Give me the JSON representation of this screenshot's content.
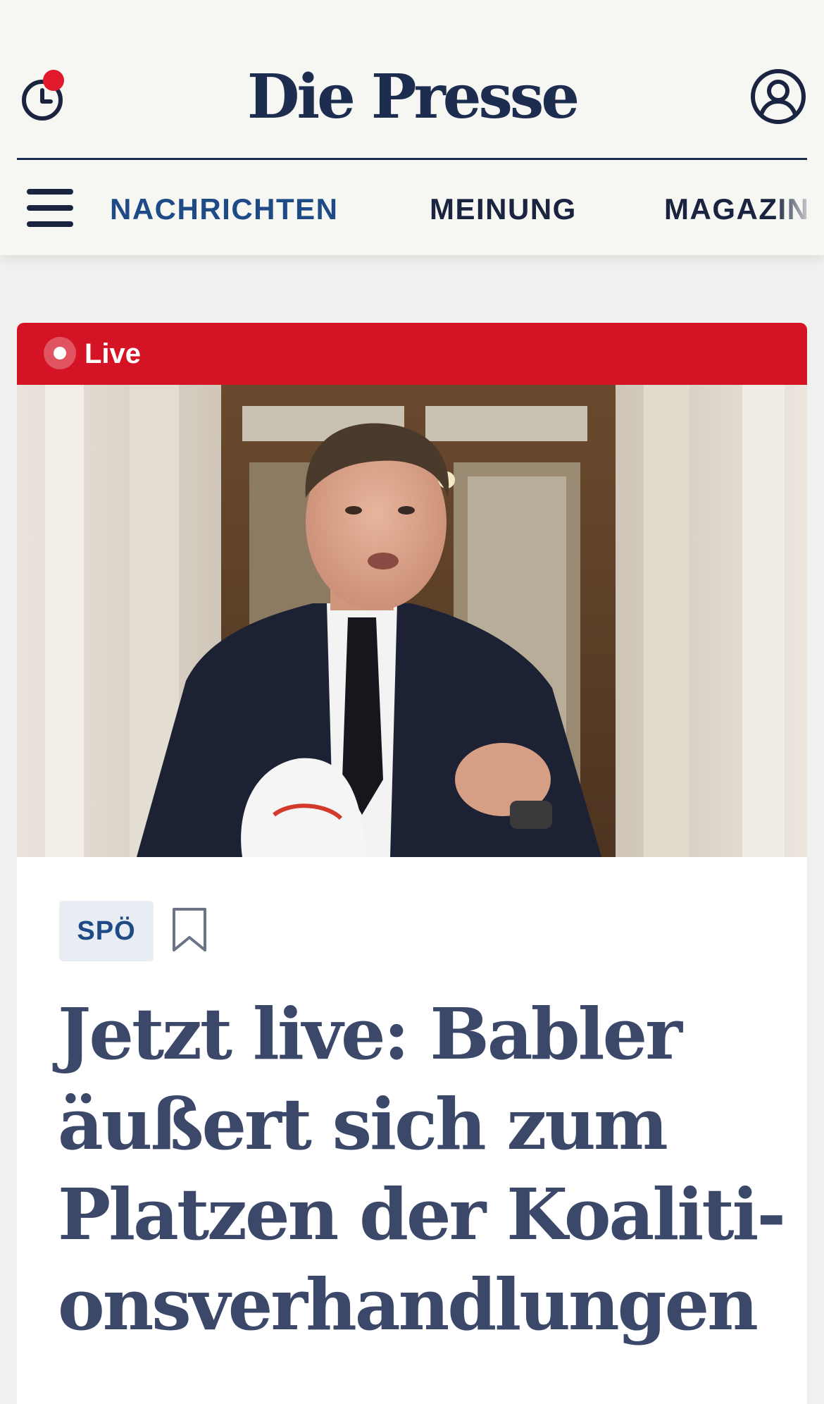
{
  "header": {
    "logo": "Die Presse",
    "notification_dot_color": "#e2182d",
    "icons": [
      "history-icon",
      "account-icon",
      "menu-icon"
    ]
  },
  "nav": {
    "items": [
      {
        "label": "NACHRICHTEN",
        "active": true
      },
      {
        "label": "MEINUNG",
        "active": false
      },
      {
        "label": "MAGAZIN",
        "active": false
      }
    ]
  },
  "article": {
    "live_label": "Live",
    "live_color": "#d41325",
    "tag": "SPÖ",
    "headline_lines": [
      "Jetzt live: Babler",
      "äußert sich zum",
      "Platzen der Koaliti-",
      "onsverhandlungen"
    ],
    "image_icon": "bookmark-icon"
  },
  "colors": {
    "brand_navy": "#1d2d4f",
    "nav_active": "#1e4a86",
    "headline": "#3c4869",
    "background": "#f6f6f3"
  }
}
